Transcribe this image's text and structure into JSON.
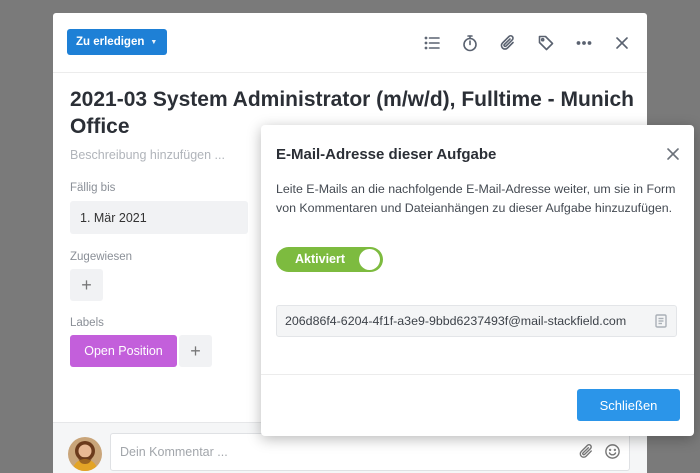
{
  "task": {
    "status_label": "Zu erledigen",
    "title": "2021-03 System Administrator (m/w/d), Fulltime - Munich Office",
    "description_placeholder": "Beschreibung hinzufügen ...",
    "due_label": "Fällig bis",
    "due_value": "1. Mär 2021",
    "assigned_label": "Zugewiesen",
    "labels_label": "Labels",
    "label_chip": "Open Position",
    "plus_symbol": "+"
  },
  "toolbar_icons": [
    "checklist-icon",
    "timer-icon",
    "paperclip-icon",
    "tag-icon",
    "more-icon",
    "close-icon"
  ],
  "comment": {
    "placeholder": "Dein Kommentar ..."
  },
  "email_popup": {
    "title": "E-Mail-Adresse dieser Aufgabe",
    "description": "Leite E-Mails an die nachfolgende E-Mail-Adresse weiter, um sie in Form von Kommentaren und Dateianhängen zu dieser Aufgabe hinzuzufügen.",
    "toggle_label": "Aktiviert",
    "toggle_on": true,
    "email_address": "206d86f4-6204-4f1f-a3e9-9bbd6237493f@mail-stackfield.com",
    "close_button": "Schließen"
  },
  "colors": {
    "status_blue": "#1e80d6",
    "label_purple": "#c35fdb",
    "toggle_green": "#7dbb3f",
    "button_blue": "#2b95e9"
  }
}
